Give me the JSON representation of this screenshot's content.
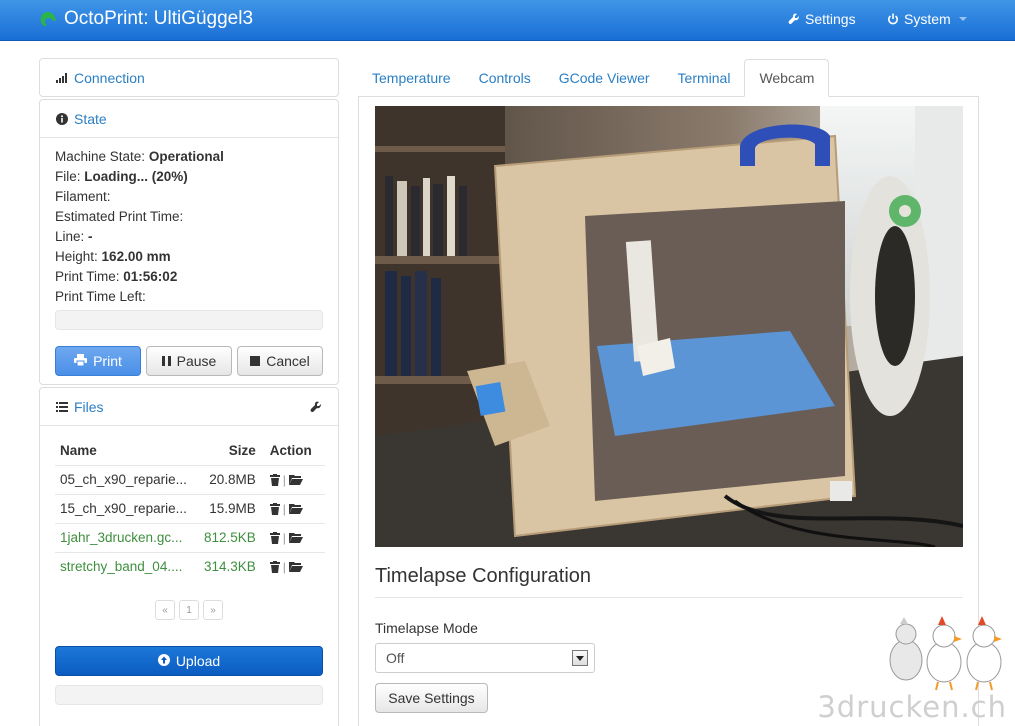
{
  "app": {
    "title": "OctoPrint: UltiGüggel3"
  },
  "navbar": {
    "settings_label": "Settings",
    "system_label": "System"
  },
  "sidebar": {
    "connection": {
      "title": "Connection"
    },
    "state": {
      "title": "State",
      "machine_state_label": "Machine State:",
      "machine_state_value": "Operational",
      "file_label": "File:",
      "file_value": "Loading... (20%)",
      "filament_label": "Filament:",
      "estimated_label": "Estimated Print Time:",
      "line_label": "Line:",
      "line_value": "-",
      "height_label": "Height:",
      "height_value": "162.00 mm",
      "print_time_label": "Print Time:",
      "print_time_value": "01:56:02",
      "print_time_left_label": "Print Time Left:",
      "print_label": "Print",
      "pause_label": "Pause",
      "cancel_label": "Cancel"
    },
    "files": {
      "title": "Files",
      "columns": [
        "Name",
        "Size",
        "Action"
      ],
      "rows": [
        {
          "name": "05_ch_x90_reparie...",
          "size": "20.8MB",
          "green": false
        },
        {
          "name": "15_ch_x90_reparie...",
          "size": "15.9MB",
          "green": false
        },
        {
          "name": "1jahr_3drucken.gc...",
          "size": "812.5KB",
          "green": true
        },
        {
          "name": "stretchy_band_04....",
          "size": "314.3KB",
          "green": true
        }
      ],
      "pager": [
        "«",
        "1",
        "»"
      ],
      "upload_label": "Upload"
    }
  },
  "tabs": [
    "Temperature",
    "Controls",
    "GCode Viewer",
    "Terminal",
    "Webcam"
  ],
  "active_tab": "Webcam",
  "timelapse": {
    "heading": "Timelapse Configuration",
    "mode_label": "Timelapse Mode",
    "mode_value": "Off",
    "save_label": "Save Settings"
  },
  "watermark": "3drucken.ch",
  "colors": {
    "navbar": "#2a80de",
    "link": "#2a7fc4",
    "primary_button": "#5b9bea",
    "upload_button": "#1468cc",
    "green_file": "#3e8f3e"
  }
}
